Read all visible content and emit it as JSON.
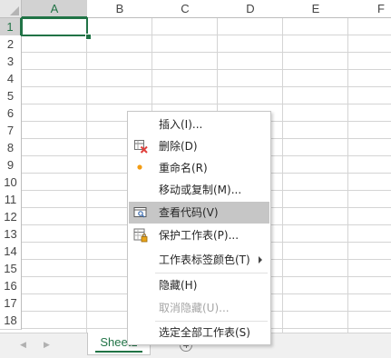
{
  "grid": {
    "columns": [
      "A",
      "B",
      "C",
      "D",
      "E",
      "F"
    ],
    "rows": [
      "1",
      "2",
      "3",
      "4",
      "5",
      "6",
      "7",
      "8",
      "9",
      "10",
      "11",
      "12",
      "13",
      "14",
      "15",
      "16",
      "17",
      "18"
    ],
    "active_column": "A",
    "active_row": "1"
  },
  "context_menu": {
    "items": [
      {
        "label": "插入(I)...",
        "icon": null,
        "enabled": true,
        "highlighted": false,
        "submenu": false
      },
      {
        "label": "删除(D)",
        "icon": "delete-sheet-icon",
        "enabled": true,
        "highlighted": false,
        "submenu": false
      },
      {
        "label": "重命名(R)",
        "icon": "rename-dot-icon",
        "enabled": true,
        "highlighted": false,
        "submenu": false
      },
      {
        "label": "移动或复制(M)...",
        "icon": null,
        "enabled": true,
        "highlighted": false,
        "submenu": false
      },
      {
        "label": "查看代码(V)",
        "icon": "view-code-icon",
        "enabled": true,
        "highlighted": true,
        "submenu": false
      },
      {
        "label": "保护工作表(P)...",
        "icon": "protect-sheet-icon",
        "enabled": true,
        "highlighted": false,
        "submenu": false
      },
      {
        "label": "工作表标签颜色(T)",
        "icon": null,
        "enabled": true,
        "highlighted": false,
        "submenu": true
      },
      {
        "label": "隐藏(H)",
        "icon": null,
        "enabled": true,
        "highlighted": false,
        "submenu": false
      },
      {
        "label": "取消隐藏(U)...",
        "icon": null,
        "enabled": false,
        "highlighted": false,
        "submenu": false
      },
      {
        "label": "选定全部工作表(S)",
        "icon": null,
        "enabled": true,
        "highlighted": false,
        "submenu": false
      }
    ]
  },
  "sheet_tabs": {
    "active_sheet": "Sheet1",
    "prev_icon": "scroll-left-icon",
    "next_icon": "scroll-right-icon",
    "add_icon": "add-sheet-icon"
  },
  "colors": {
    "accent": "#217346",
    "menu_highlight": "#c6c6c6",
    "disabled_text": "#a6a6a6",
    "rename_dot": "#f39c12",
    "delete_x": "#e0403c"
  }
}
